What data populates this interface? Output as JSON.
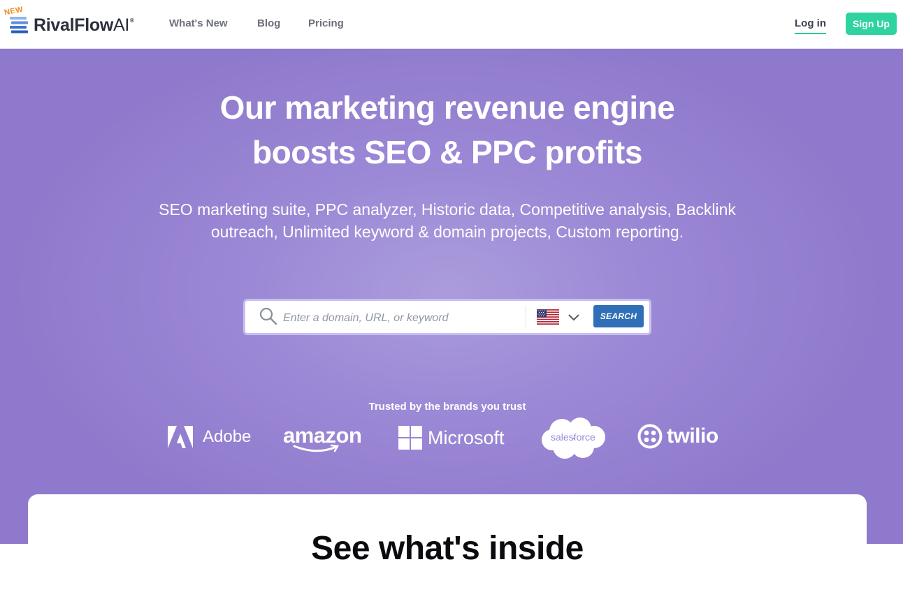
{
  "header": {
    "logo": {
      "badge": "NEW",
      "name": "RivalFlow",
      "suffix": "AI",
      "reg": "®"
    },
    "nav": [
      "What's New",
      "Blog",
      "Pricing"
    ],
    "login": "Log in",
    "signup": "Sign Up"
  },
  "hero": {
    "title_line1": "Our marketing revenue engine",
    "title_line2": "boosts SEO & PPC profits",
    "subtitle": "SEO marketing suite, PPC analyzer, Historic data, Competitive analysis, Backlink outreach, Unlimited keyword & domain projects, Custom reporting.",
    "search": {
      "placeholder": "Enter a domain, URL, or keyword",
      "value": "",
      "country": "us-flag-icon",
      "button": "SEARCH"
    },
    "trusted_label": "Trusted by the brands you trust",
    "brands": [
      "Adobe",
      "amazon",
      "Microsoft",
      "salesforce",
      "twilio"
    ]
  },
  "card": {
    "title": "See what's inside"
  },
  "colors": {
    "hero_bg": "#9c89d6",
    "signup_bg": "#2ed3a0",
    "search_button": "#2f6fb7",
    "login_underline": "#2ec99a",
    "logo_badge": "#f08a24"
  }
}
